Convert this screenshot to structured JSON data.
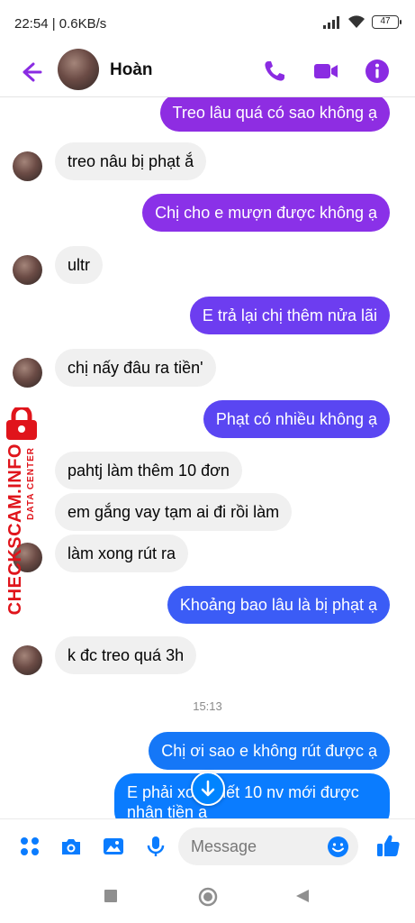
{
  "status_bar": {
    "time_speed": "22:54 | 0.6KB/s",
    "battery": "47"
  },
  "header": {
    "contact_name": "Hoàn"
  },
  "colors": {
    "accent": "#8a2be2",
    "outgoing_purple": "#8e2de2",
    "outgoing_blue": "#0a7cff",
    "incoming_bg": "#f0f0f0"
  },
  "messages": [
    {
      "dir": "out",
      "text": "Treo lâu quá có sao không ạ"
    },
    {
      "dir": "in",
      "text": "treo nâu bị phạt ắ"
    },
    {
      "dir": "out",
      "text": "Chị cho e mượn được không ạ"
    },
    {
      "dir": "in",
      "text": "ultr"
    },
    {
      "dir": "out",
      "text": "E trả lại chị thêm nửa lãi"
    },
    {
      "dir": "in",
      "text": "chị nấy đâu ra tiền'"
    },
    {
      "dir": "out",
      "text": "Phạt có nhiều không ạ"
    },
    {
      "dir": "in",
      "text": "pahtj làm thêm 10 đơn"
    },
    {
      "dir": "in",
      "text": "em gắng vay tạm ai đi rồi làm"
    },
    {
      "dir": "in",
      "text": "làm xong rút ra"
    },
    {
      "dir": "out",
      "text": "Khoảng bao lâu là bị phạt ạ"
    },
    {
      "dir": "in",
      "text": "k đc treo quá 3h"
    },
    {
      "dir": "out",
      "text": "Chị ơi sao e không rút được ạ"
    },
    {
      "dir": "out",
      "text": "E phải xong hết 10 nv mới được nhận tiền ạ"
    }
  ],
  "timestamp": "15:13",
  "composer": {
    "placeholder": "Message"
  },
  "watermark": {
    "brand": "CHECKSCAM.INFO",
    "sub": "DATA CENTER"
  },
  "icons": [
    "back-arrow-icon",
    "phone-icon",
    "video-call-icon",
    "info-icon",
    "apps-grid-icon",
    "camera-icon",
    "image-icon",
    "microphone-icon",
    "emoji-icon",
    "thumbs-up-icon",
    "arrow-down-icon",
    "square-nav-icon",
    "circle-nav-icon",
    "triangle-back-nav-icon"
  ]
}
